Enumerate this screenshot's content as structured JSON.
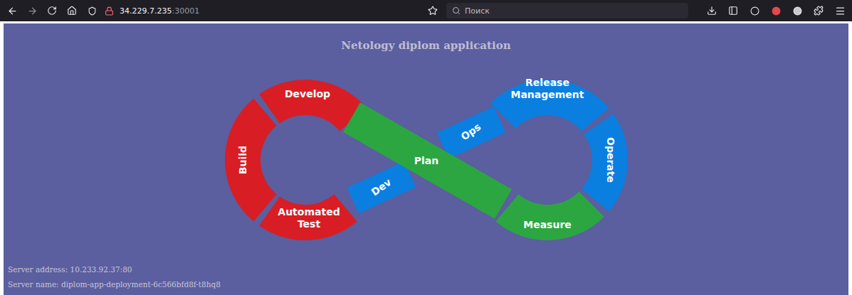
{
  "browser": {
    "url": {
      "host": "34.229.7.235",
      "port": ":30001"
    },
    "search": {
      "placeholder": "Поиск"
    }
  },
  "page": {
    "title": "Netology diplom application",
    "diagram": {
      "stages": [
        {
          "lines": [
            "Develop"
          ],
          "color": "#d81e24"
        },
        {
          "lines": [
            "Build"
          ],
          "color": "#d81e24"
        },
        {
          "lines": [
            "Automated",
            "Test"
          ],
          "color": "#d81e24"
        },
        {
          "lines": [
            "Dev"
          ],
          "color": "#0a7fe0"
        },
        {
          "lines": [
            "Release",
            "Management"
          ],
          "color": "#0a7fe0"
        },
        {
          "lines": [
            "Operate"
          ],
          "color": "#0a7fe0"
        },
        {
          "lines": [
            "Measure"
          ],
          "color": "#2ca641"
        },
        {
          "lines": [
            "Ops"
          ],
          "color": "#0a7fe0"
        },
        {
          "lines": [
            "Plan"
          ],
          "color": "#2ca641"
        }
      ]
    },
    "server": [
      "Server address: 10.233.92.37:80",
      "Server name: diplom-app-deployment-6c566bfd8f-t8hq8"
    ]
  }
}
